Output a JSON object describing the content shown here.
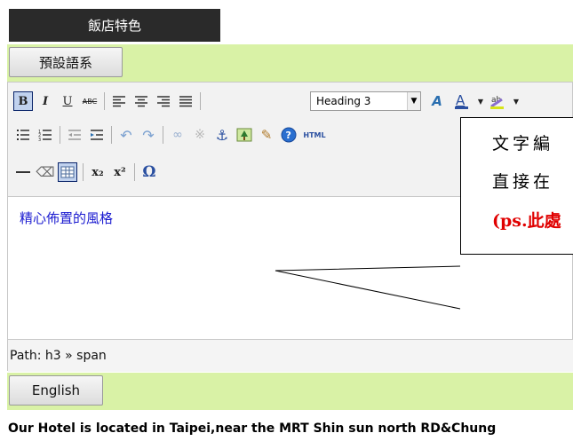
{
  "header": {
    "title": "飯店特色"
  },
  "language_default": {
    "label": "預設語系"
  },
  "toolbar": {
    "bold": "B",
    "italic": "I",
    "underline": "U",
    "strikethrough": "ABC",
    "format_select": {
      "value": "Heading 3"
    },
    "html_label": "HTML",
    "subscript": "x₂",
    "superscript": "x²",
    "special_char": "Ω"
  },
  "content": {
    "text": "精心佈置的風格"
  },
  "callout": {
    "line1": "文字編",
    "line2": "直接在",
    "line3": "(ps.此處"
  },
  "path": {
    "text": "Path: h3 » span"
  },
  "language_english": {
    "label": "English"
  },
  "footer": {
    "text": "Our Hotel is located in Taipei,near the MRT Shin sun north RD&Chung"
  },
  "colors": {
    "title_bg": "#2a2a2a",
    "green_row": "#d9f2a6",
    "content_text": "#1a1ad0",
    "callout_red": "#e00000"
  }
}
